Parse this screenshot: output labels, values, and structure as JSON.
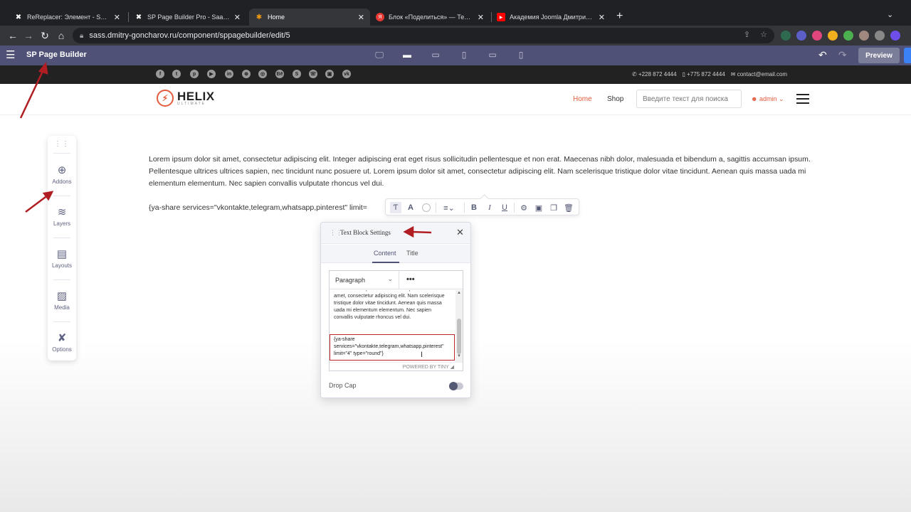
{
  "browser": {
    "tabs": [
      {
        "title": "ReReplacer: Элемент - Saas Фрэй",
        "icon": "joomla-icon",
        "active": false
      },
      {
        "title": "SP Page Builder Pro - Saas Фрэй",
        "icon": "joomla-icon",
        "active": false
      },
      {
        "title": "Home",
        "icon": "joomla-icon",
        "active": true
      },
      {
        "title": "Блок «Поделиться» — Технолог",
        "icon": "yandex-icon",
        "active": false
      },
      {
        "title": "Академия Joomla Дмитрия Гон",
        "icon": "youtube-icon",
        "active": false
      }
    ],
    "url": "sass.dmitry-goncharov.ru/component/sppagebuilder/edit/5"
  },
  "builder": {
    "title": "SP Page Builder",
    "preview_label": "Preview"
  },
  "topbar": {
    "social": [
      "f",
      "t",
      "p",
      "▶",
      "in",
      "⊛",
      "◎",
      "Bē",
      "S",
      "☏",
      "▣",
      "vk"
    ],
    "phone": "+228 872 4444",
    "mobile": "+775 872 4444",
    "email": "contact@email.com"
  },
  "site": {
    "logo_text": "HELIX",
    "logo_sub": "ULTIMATE",
    "nav": [
      "Home",
      "Shop"
    ],
    "search_placeholder": "Введите текст для поиска",
    "admin_label": "admin"
  },
  "sidebar": {
    "items": [
      {
        "label": "Addons",
        "icon": "plus-circle-icon"
      },
      {
        "label": "Layers",
        "icon": "layers-icon"
      },
      {
        "label": "Layouts",
        "icon": "layout-icon"
      },
      {
        "label": "Media",
        "icon": "media-icon"
      },
      {
        "label": "Options",
        "icon": "tools-icon"
      }
    ]
  },
  "content": {
    "paragraph": "Lorem ipsum dolor sit amet, consectetur adipiscing elit. Integer adipiscing erat eget risus sollicitudin pellentesque et non erat. Maecenas nibh dolor, malesuada et bibendum a, sagittis accumsan ipsum. Pellentesque ultrices ultrices sapien, nec tincidunt nunc posuere ut. Lorem ipsum dolor sit amet, consectetur adipiscing elit. Nam scelerisque tristique dolor vitae tincidunt. Aenean quis massa uada mi elementum elementum. Nec sapien convallis vulputate rhoncus vel dui.",
    "shortcode": "{ya-share services=\"vkontakte,telegram,whatsapp,pinterest\" limit="
  },
  "settings": {
    "title": "Text Block Settings",
    "tabs": [
      "Content",
      "Title"
    ],
    "format": "Paragraph",
    "more": "•••",
    "editor_text": "tincidunt nunc posuere ut. Lorem ipsum dolor sit amet, consectetur adipiscing elit. Nam scelerisque tristique dolor vitae tincidunt. Aenean quis massa uada mi elementum elementum. Nec sapien convallis vulputate rhoncus vel dui.",
    "editor_shortcode": "{ya-share services=\"vkontakte,telegram,whatsapp,pinterest\" limit=\"4\" type=\"round\"}",
    "powered": "POWERED BY TINY",
    "dropcap_label": "Drop Cap",
    "dropcap_on": false
  },
  "colors": {
    "builder_bar": "#4f5276",
    "accent": "#e25b3d",
    "annotation": "#b01e23"
  }
}
